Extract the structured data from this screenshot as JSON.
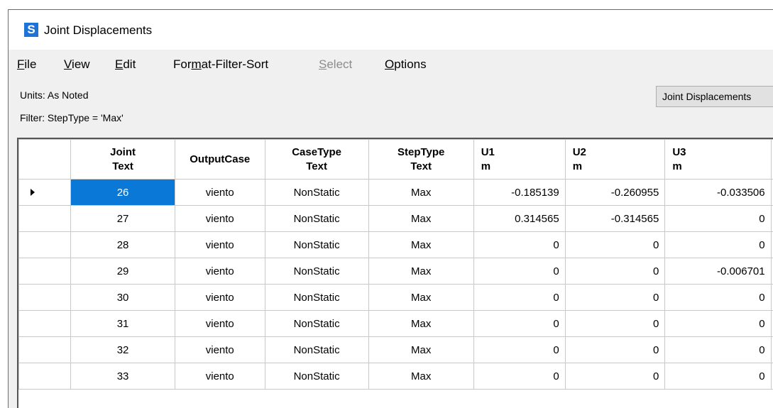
{
  "window": {
    "app_icon": "S",
    "title": "Joint Displacements"
  },
  "menu": [
    {
      "pre": "",
      "key": "F",
      "post": "ile",
      "disabled": false
    },
    {
      "pre": "",
      "key": "V",
      "post": "iew",
      "disabled": false
    },
    {
      "pre": "",
      "key": "E",
      "post": "dit",
      "disabled": false
    },
    {
      "pre": "For",
      "key": "m",
      "post": "at-Filter-Sort",
      "disabled": false
    },
    {
      "pre": "",
      "key": "S",
      "post": "elect",
      "disabled": true
    },
    {
      "pre": "",
      "key": "O",
      "post": "ptions",
      "disabled": false
    }
  ],
  "info": {
    "units": "Units:  As Noted",
    "filter": "Filter:  StepType = 'Max'"
  },
  "view_button": {
    "label": "Joint Displacements"
  },
  "table": {
    "headers": [
      {
        "line1": "Joint",
        "line2": "Text"
      },
      {
        "line1": "OutputCase",
        "line2": ""
      },
      {
        "line1": "CaseType",
        "line2": "Text"
      },
      {
        "line1": "StepType",
        "line2": "Text"
      },
      {
        "line1": "U1",
        "line2": "m"
      },
      {
        "line1": "U2",
        "line2": "m"
      },
      {
        "line1": "U3",
        "line2": "m"
      }
    ],
    "rows": [
      [
        "26",
        "viento",
        "NonStatic",
        "Max",
        "-0.185139",
        "-0.260955",
        "-0.033506"
      ],
      [
        "27",
        "viento",
        "NonStatic",
        "Max",
        "0.314565",
        "-0.314565",
        "0"
      ],
      [
        "28",
        "viento",
        "NonStatic",
        "Max",
        "0",
        "0",
        "0"
      ],
      [
        "29",
        "viento",
        "NonStatic",
        "Max",
        "0",
        "0",
        "-0.006701"
      ],
      [
        "30",
        "viento",
        "NonStatic",
        "Max",
        "0",
        "0",
        "0"
      ],
      [
        "31",
        "viento",
        "NonStatic",
        "Max",
        "0",
        "0",
        "0"
      ],
      [
        "32",
        "viento",
        "NonStatic",
        "Max",
        "0",
        "0",
        "0"
      ],
      [
        "33",
        "viento",
        "NonStatic",
        "Max",
        "0",
        "0",
        "0"
      ]
    ],
    "selected_row": 0,
    "selected_color": "#0a78d7"
  }
}
